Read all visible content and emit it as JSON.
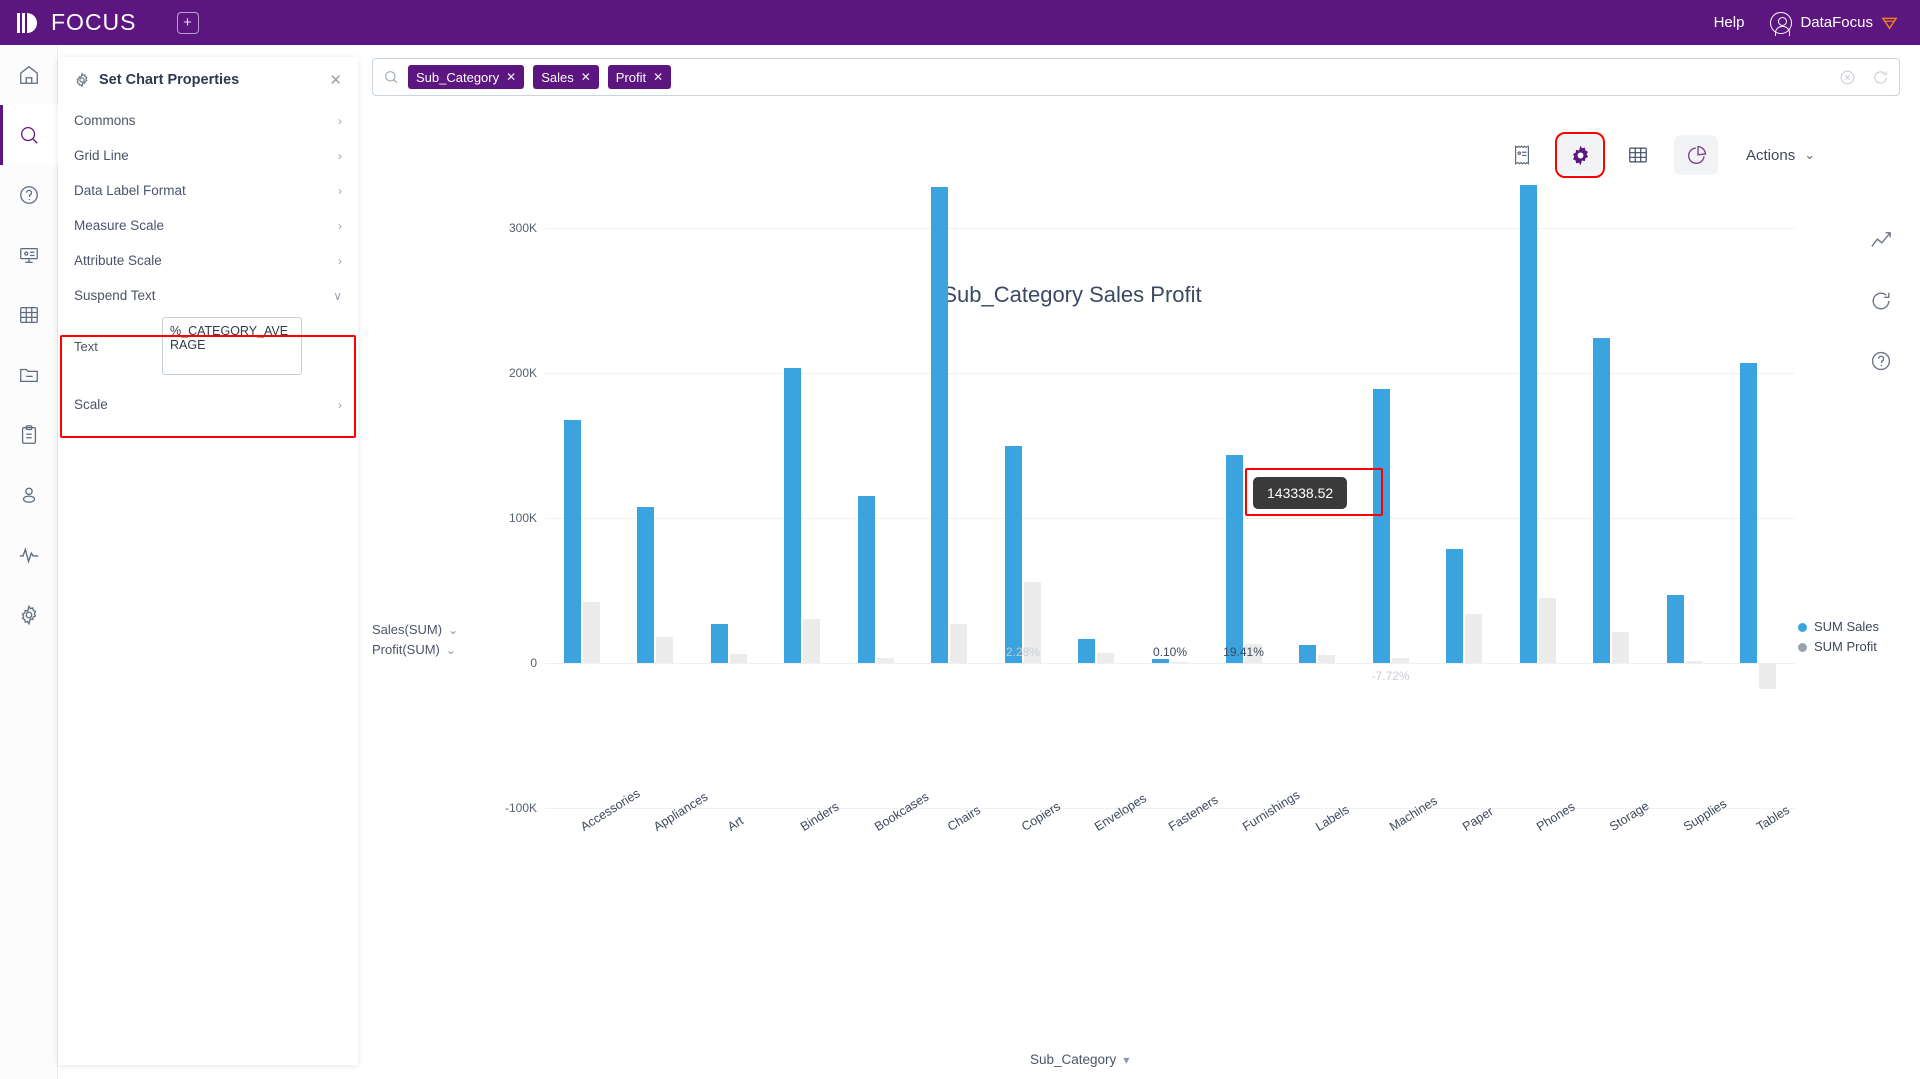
{
  "topbar": {
    "logo_text": "FOCUS",
    "new_tab_label": "+",
    "help_label": "Help",
    "user_label": "DataFocus"
  },
  "rail": {
    "items": [
      {
        "icon": "home-icon",
        "active": false
      },
      {
        "icon": "search-icon",
        "active": true
      },
      {
        "icon": "question-icon",
        "active": false
      },
      {
        "icon": "presentation-icon",
        "active": false
      },
      {
        "icon": "table-icon",
        "active": false
      },
      {
        "icon": "folder-minus-icon",
        "active": false
      },
      {
        "icon": "clipboard-icon",
        "active": false
      },
      {
        "icon": "user-icon",
        "active": false
      },
      {
        "icon": "pulse-icon",
        "active": false
      },
      {
        "icon": "settings-icon",
        "active": false
      }
    ]
  },
  "panel": {
    "title": "Set Chart Properties",
    "close_label": "✕",
    "rows": [
      {
        "label": "Commons",
        "chevron": "›"
      },
      {
        "label": "Grid Line",
        "chevron": "›"
      },
      {
        "label": "Data Label Format",
        "chevron": "›"
      },
      {
        "label": "Measure Scale",
        "chevron": "›"
      },
      {
        "label": "Attribute Scale",
        "chevron": "›"
      }
    ],
    "suspend": {
      "label": "Suspend Text",
      "chevron": "∨",
      "field_label": "Text",
      "field_value": "%_CATEGORY_AVERAGE",
      "field_placeholder": ""
    },
    "scale_row": {
      "label": "Scale",
      "chevron": "›"
    },
    "highlight_color": "#ff0000"
  },
  "search": {
    "placeholder": "",
    "chips": [
      {
        "label": "Sub_Category",
        "close": "✕"
      },
      {
        "label": "Sales",
        "close": "✕"
      },
      {
        "label": "Profit",
        "close": "✕"
      }
    ],
    "clear_icon": "clear-circle-icon",
    "refresh_icon": "refresh-icon"
  },
  "chart_toolbar": {
    "tools": [
      {
        "name": "receipt-icon",
        "selected": false,
        "shaded": false,
        "highlighted": false
      },
      {
        "name": "gear-icon",
        "selected": true,
        "shaded": true,
        "highlighted": true
      },
      {
        "name": "table-grid-icon",
        "selected": false,
        "shaded": false,
        "highlighted": false
      },
      {
        "name": "pie-chart-icon",
        "selected": false,
        "shaded": true,
        "highlighted": false
      }
    ],
    "actions_label": "Actions",
    "actions_chevron": "⌄"
  },
  "right_tools": [
    {
      "name": "line-chart-icon"
    },
    {
      "name": "refresh-icon"
    },
    {
      "name": "help-circle-icon"
    }
  ],
  "measure_menu": [
    {
      "label": "Sales(SUM)",
      "chevron": "⌄"
    },
    {
      "label": "Profit(SUM)",
      "chevron": "⌄"
    }
  ],
  "tooltip": {
    "value": "143338.52"
  },
  "chart_data": {
    "type": "bar",
    "title": "Sub_Category Sales Profit",
    "xlabel": "Sub_Category",
    "ylabel": "",
    "ylim": [
      -100000,
      300000
    ],
    "yticks": [
      300000,
      200000,
      100000,
      0,
      -100000
    ],
    "ytick_labels": [
      "300K",
      "200K",
      "100K",
      "0",
      "-100K"
    ],
    "grid": true,
    "legend_position": "right",
    "categories": [
      "Accessories",
      "Appliances",
      "Art",
      "Binders",
      "Bookcases",
      "Chairs",
      "Copiers",
      "Envelopes",
      "Fasteners",
      "Furnishings",
      "Labels",
      "Machines",
      "Paper",
      "Phones",
      "Storage",
      "Supplies",
      "Tables"
    ],
    "series": [
      {
        "name": "SUM Sales",
        "color": "#3ba3dd",
        "values": [
          167380,
          107532,
          27119,
          203413,
          114880,
          328449,
          149528,
          16476,
          3024,
          143338,
          12486,
          189239,
          78479,
          330007,
          223844,
          46674,
          206966
        ]
      },
      {
        "name": "SUM Profit",
        "color": "#ececec",
        "values": [
          41937,
          18138,
          6528,
          30222,
          3473,
          26590,
          55618,
          6964,
          949,
          13059,
          5546,
          3384,
          34054,
          44516,
          21279,
          1189,
          -17725
        ]
      }
    ],
    "data_labels": [
      {
        "category": "Copiers",
        "text": "2.28%"
      },
      {
        "category": "Fasteners",
        "text": "0.10%"
      },
      {
        "category": "Furnishings",
        "text": "19.41%"
      },
      {
        "category": "Machines",
        "text": "-7.72%"
      }
    ]
  }
}
